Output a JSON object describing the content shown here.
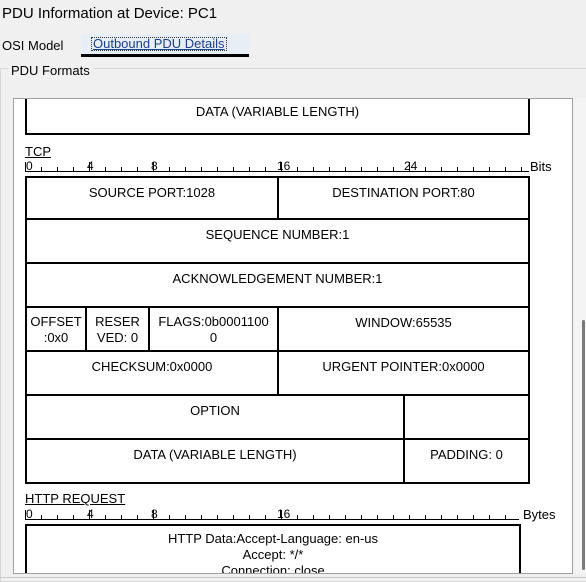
{
  "window": {
    "title": "PDU Information at Device: PC1"
  },
  "tabs": {
    "osi": "OSI Model",
    "outbound": "Outbound PDU Details"
  },
  "group": {
    "label": "PDU Formats"
  },
  "ip_tail": {
    "data": "DATA (VARIABLE LENGTH)"
  },
  "tcp": {
    "title": "TCP",
    "ruler": {
      "labels": [
        "0",
        "4",
        "8",
        "16",
        "24"
      ],
      "unit": "Bits"
    },
    "source_port": "SOURCE PORT:1028",
    "dest_port": "DESTINATION PORT:80",
    "sequence": "SEQUENCE NUMBER:1",
    "ack": "ACKNOWLEDGEMENT NUMBER:1",
    "offset_1": "OFFSET",
    "offset_2": ":0x0",
    "reserved_1": "RESER",
    "reserved_2": "VED: 0",
    "flags_1": "FLAGS:0b0001100",
    "flags_2": "0",
    "window": "WINDOW:65535",
    "checksum": "CHECKSUM:0x0000",
    "urgent": "URGENT POINTER:0x0000",
    "option": "OPTION",
    "data": "DATA (VARIABLE LENGTH)",
    "padding": "PADDING: 0"
  },
  "http": {
    "title": "HTTP REQUEST",
    "ruler": {
      "labels": [
        "0",
        "4",
        "8",
        "16"
      ],
      "unit": "Bytes"
    },
    "line1": "HTTP Data:Accept-Language: en-us",
    "line2": "Accept: */*",
    "line3": "Connection: close"
  }
}
